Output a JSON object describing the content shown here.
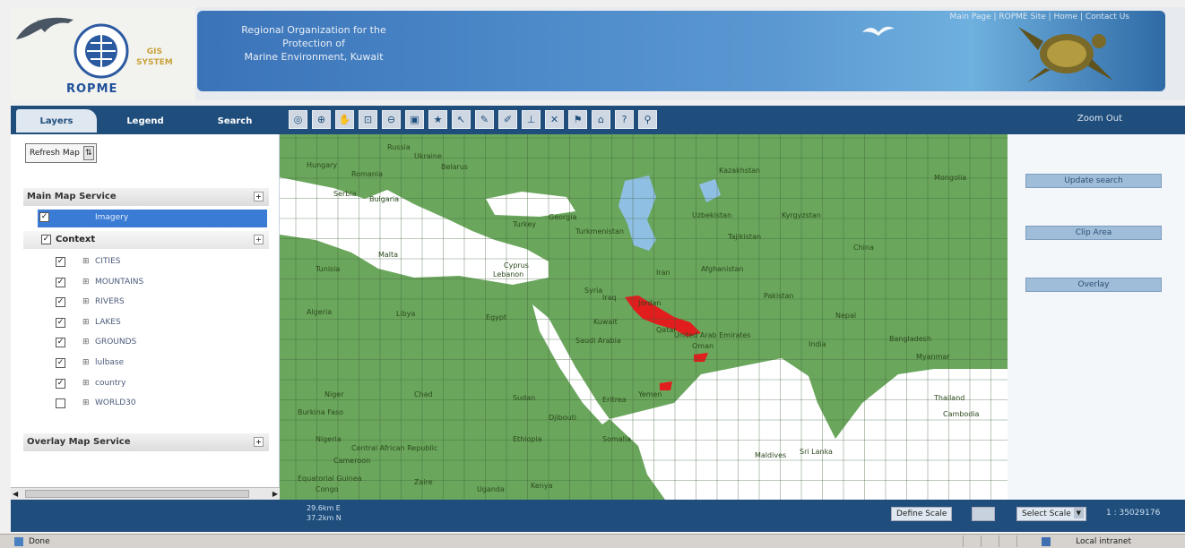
{
  "header": {
    "logo_text": "ROPME",
    "gis_label": [
      "GIS",
      "SYSTEM"
    ],
    "org_name_lines": [
      "Regional Organization for the",
      "Protection of",
      "Marine Environment, Kuwait"
    ],
    "banner_link_text": "Main Page | ROPME Site | Home | Contact Us"
  },
  "nav": {
    "tabs": [
      "Layers",
      "Legend",
      "Search"
    ],
    "tool_icons": [
      "zoom-full",
      "zoom-in",
      "pan",
      "zoom-box",
      "zoom-out",
      "zoom-prev",
      "favorite",
      "select",
      "measure",
      "edit",
      "identify",
      "clear",
      "info",
      "print",
      "help",
      "tool"
    ],
    "zoom_label": "Zoom Out"
  },
  "left": {
    "refresh_label": "Refresh Map",
    "main_service": "Main Map Service",
    "selected_layer": "Imagery",
    "context_label": "Context",
    "layers": [
      {
        "name": "CITIES",
        "checked": true
      },
      {
        "name": "MOUNTAINS",
        "checked": true
      },
      {
        "name": "RIVERS",
        "checked": true
      },
      {
        "name": "LAKES",
        "checked": true
      },
      {
        "name": "GROUNDS",
        "checked": true
      },
      {
        "name": "lulbase",
        "checked": true
      },
      {
        "name": "country",
        "checked": true
      },
      {
        "name": "WORLD30",
        "checked": false
      }
    ],
    "overlay_service": "Overlay Map Service"
  },
  "map": {
    "labels": [
      "Russia",
      "Ukraine",
      "Belarus",
      "Hungary",
      "Romania",
      "Kazakhstan",
      "Mongolia",
      "Serbia",
      "Bulgaria",
      "Georgia",
      "Uzbekistan",
      "Kyrgyzstan",
      "Turkey",
      "Turkmenistan",
      "Tajikistan",
      "China",
      "Malta",
      "Tunisia",
      "Cyprus",
      "Lebanon",
      "Iraq",
      "Iran",
      "Afghanistan",
      "Pakistan",
      "Nepal",
      "Algeria",
      "Libya",
      "Egypt",
      "Saudi Arabia",
      "Oman",
      "India",
      "Bangladesh",
      "Myanmar",
      "Niger",
      "Chad",
      "Sudan",
      "Eritrea",
      "Yemen",
      "Djibouti",
      "Burkina Faso",
      "Nigeria",
      "Central African Republic",
      "Ethiopia",
      "Somalia",
      "Cameroon",
      "Maldives",
      "Sri Lanka",
      "Equatorial Guinea",
      "Congo",
      "Zaire",
      "Uganda",
      "Kenya",
      "Thailand",
      "Cambodia",
      "Jordan",
      "Syria",
      "Kuwait",
      "United Arab Emirates",
      "Qatar"
    ]
  },
  "right": {
    "update_search": "Update search",
    "clip_area": "Clip Area",
    "overlay": "Overlay"
  },
  "bottom": {
    "coord_lat": "29.6km E",
    "coord_lon": "37.2km N",
    "define_scale": "Define Scale",
    "select_scale": "Select Scale",
    "scale_value": "1 : 35029176"
  },
  "status": {
    "text": "Done",
    "zone": "Local intranet"
  },
  "colors": {
    "nav_blue": "#1f4e7d",
    "land_green": "#6aa65c",
    "water_blue": "#8fc0e4",
    "highlight_red": "#e21d1d"
  }
}
